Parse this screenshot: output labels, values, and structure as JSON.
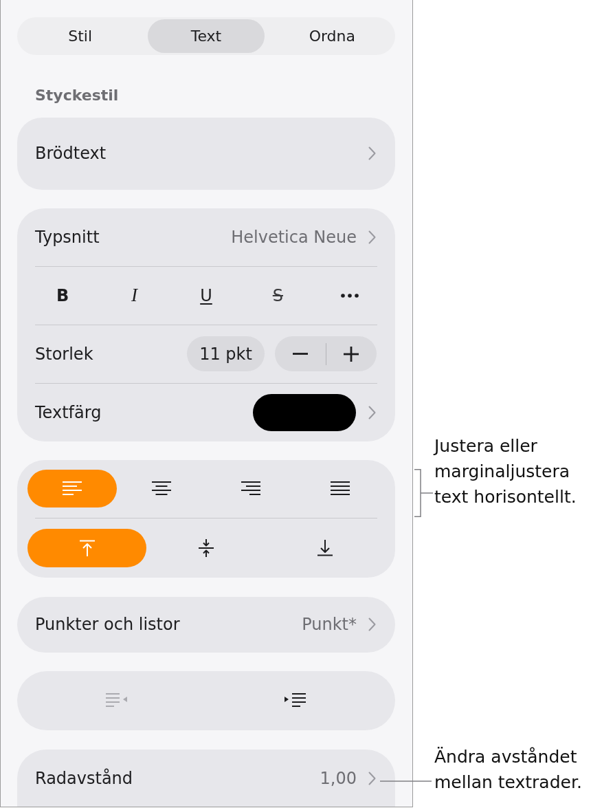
{
  "tabs": [
    {
      "label": "Stil",
      "selected": false
    },
    {
      "label": "Text",
      "selected": true
    },
    {
      "label": "Ordna",
      "selected": false
    }
  ],
  "paragraph_style": {
    "heading": "Styckestil",
    "value": "Brödtext"
  },
  "font": {
    "label": "Typsnitt",
    "value": "Helvetica Neue"
  },
  "style_buttons": [
    {
      "kind": "bold",
      "label": "B"
    },
    {
      "kind": "italic",
      "label": "I"
    },
    {
      "kind": "underline",
      "label": "U"
    },
    {
      "kind": "strikethrough",
      "label": "S"
    },
    {
      "kind": "more"
    }
  ],
  "size": {
    "label": "Storlek",
    "value": "11 pkt"
  },
  "text_color": {
    "label": "Textfärg",
    "color": "#000000"
  },
  "alignment": [
    {
      "kind": "left",
      "selected": true
    },
    {
      "kind": "center",
      "selected": false
    },
    {
      "kind": "right",
      "selected": false
    },
    {
      "kind": "justify",
      "selected": false
    }
  ],
  "vertical_alignment": [
    {
      "kind": "top",
      "selected": true
    },
    {
      "kind": "middle",
      "selected": false
    },
    {
      "kind": "bottom",
      "selected": false
    }
  ],
  "bullets": {
    "label": "Punkter och listor",
    "value": "Punkt*"
  },
  "indent": [
    {
      "kind": "outdent",
      "disabled": true
    },
    {
      "kind": "indent",
      "disabled": false
    }
  ],
  "line_spacing": {
    "label": "Radavstånd",
    "value": "1,00"
  },
  "callouts": [
    {
      "kind": "bracket",
      "text": "Justera eller marginaljustera text horisontellt."
    },
    {
      "kind": "leader",
      "text": "Ändra avståndet mellan textrader."
    }
  ]
}
